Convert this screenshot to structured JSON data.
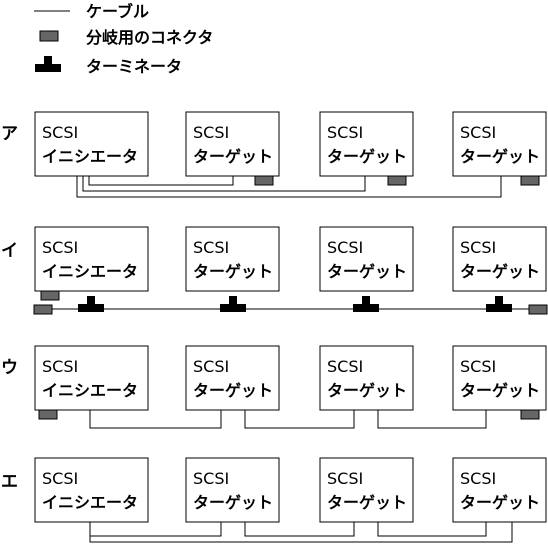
{
  "legend": {
    "cable_label": "ケーブル",
    "connector_label": "分岐用のコネクタ",
    "terminator_label": "ターミネータ"
  },
  "rows": [
    {
      "label": "ア",
      "boxes": [
        {
          "line1": "SCSI",
          "line2": "イニシエータ"
        },
        {
          "line1": "SCSI",
          "line2": "ターゲット"
        },
        {
          "line1": "SCSI",
          "line2": "ターゲット"
        },
        {
          "line1": "SCSI",
          "line2": "ターゲット"
        }
      ]
    },
    {
      "label": "イ",
      "boxes": [
        {
          "line1": "SCSI",
          "line2": "イニシエータ"
        },
        {
          "line1": "SCSI",
          "line2": "ターゲット"
        },
        {
          "line1": "SCSI",
          "line2": "ターゲット"
        },
        {
          "line1": "SCSI",
          "line2": "ターゲット"
        }
      ]
    },
    {
      "label": "ウ",
      "boxes": [
        {
          "line1": "SCSI",
          "line2": "イニシエータ"
        },
        {
          "line1": "SCSI",
          "line2": "ターゲット"
        },
        {
          "line1": "SCSI",
          "line2": "ターゲット"
        },
        {
          "line1": "SCSI",
          "line2": "ターゲット"
        }
      ]
    },
    {
      "label": "エ",
      "boxes": [
        {
          "line1": "SCSI",
          "line2": "イニシエータ"
        },
        {
          "line1": "SCSI",
          "line2": "ターゲット"
        },
        {
          "line1": "SCSI",
          "line2": "ターゲット"
        },
        {
          "line1": "SCSI",
          "line2": "ターゲット"
        }
      ]
    }
  ]
}
